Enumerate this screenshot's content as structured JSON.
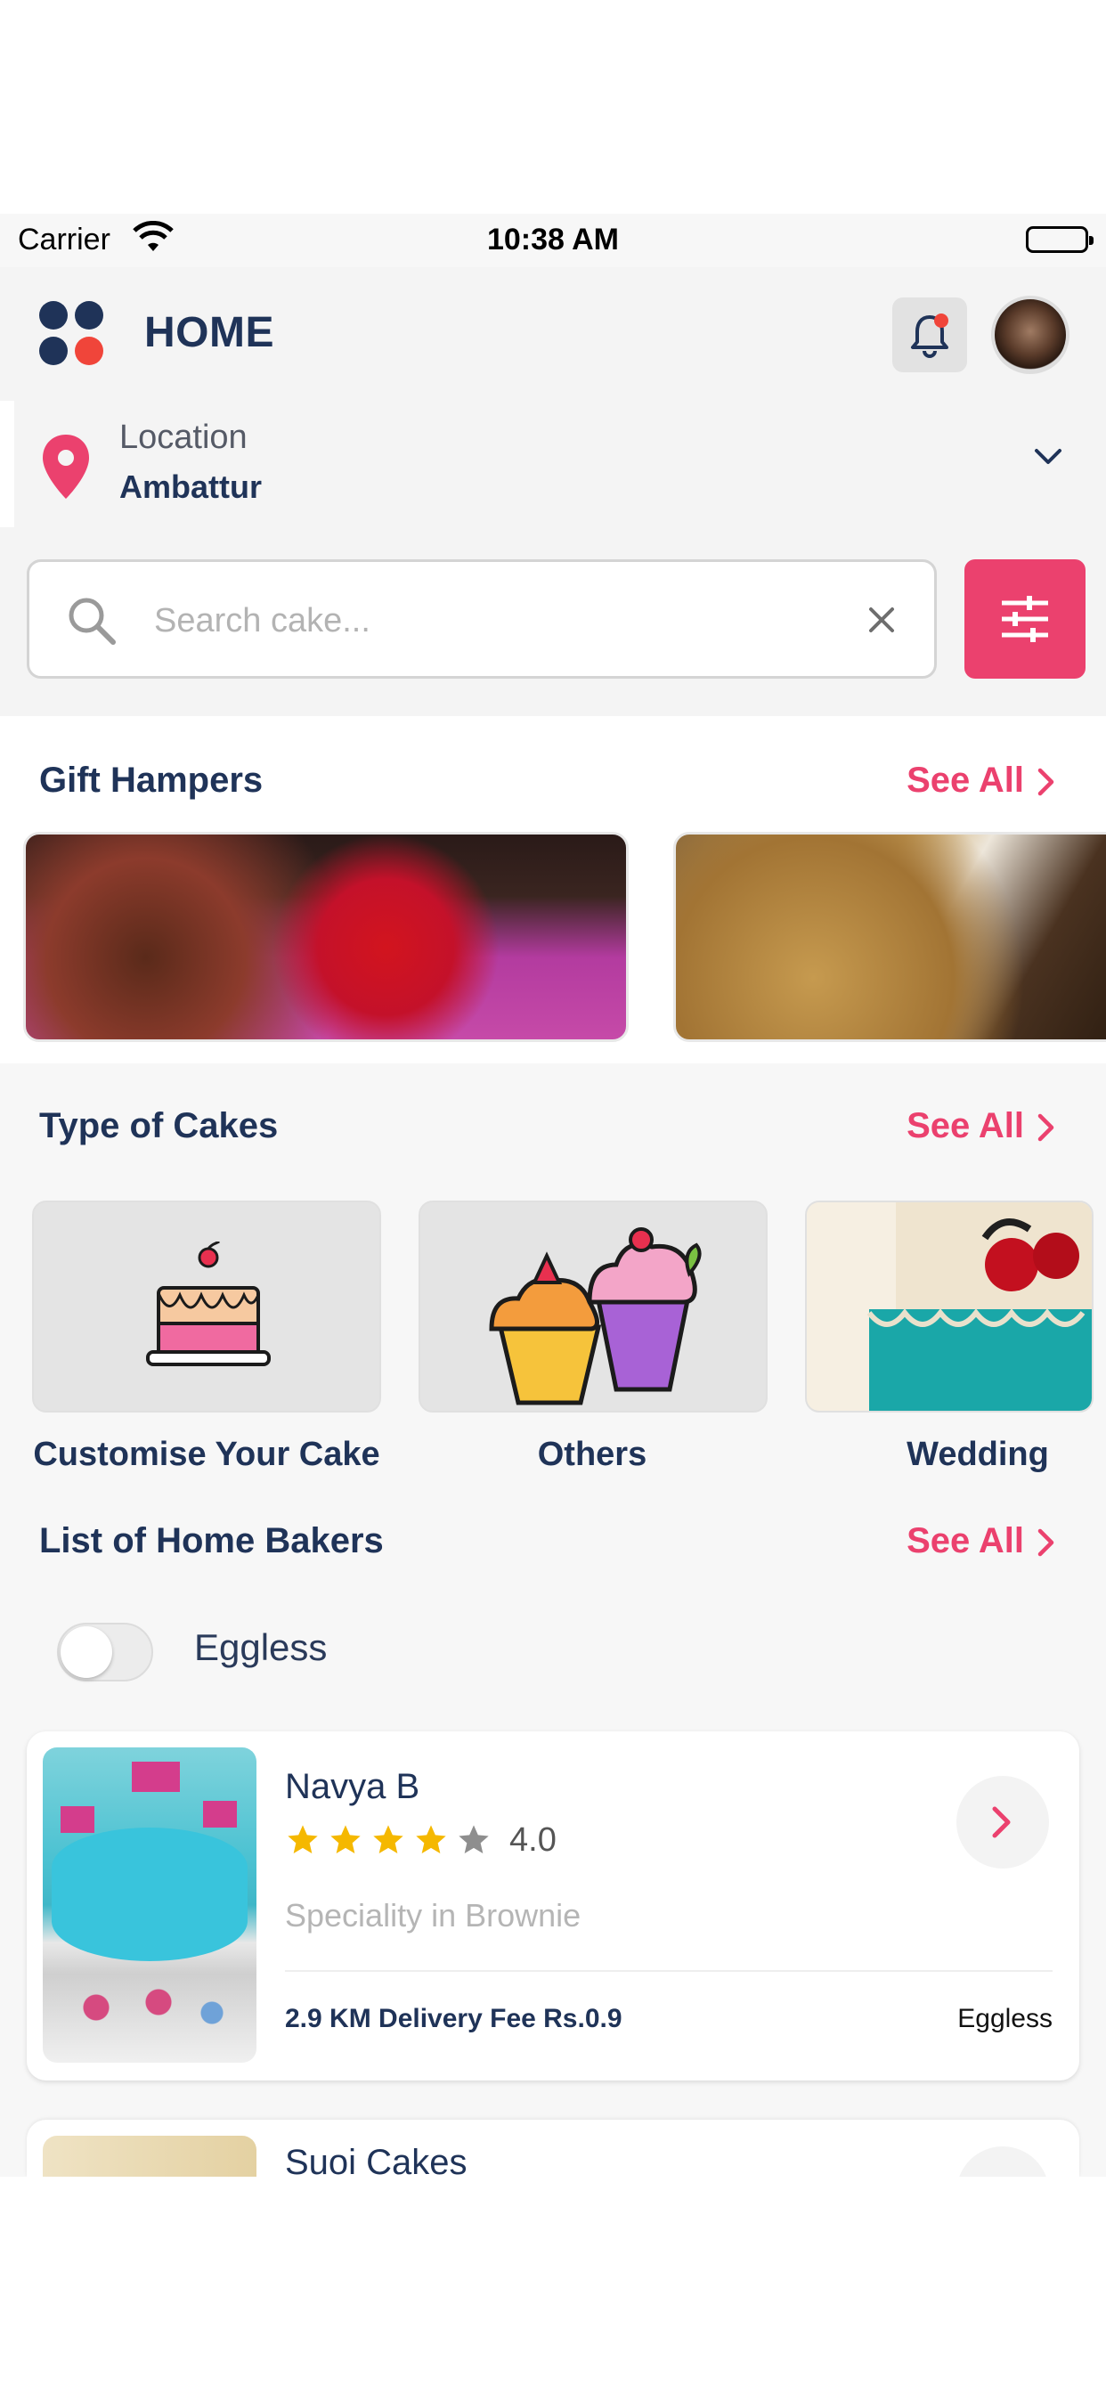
{
  "status_bar": {
    "carrier": "Carrier",
    "time": "10:38 AM"
  },
  "header": {
    "title": "HOME"
  },
  "location": {
    "label": "Location",
    "value": "Ambattur"
  },
  "search": {
    "placeholder": "Search cake..."
  },
  "gift_hampers": {
    "title": "Gift Hampers",
    "see_all": "See All"
  },
  "cake_types": {
    "title": "Type of Cakes",
    "see_all": "See All",
    "items": [
      {
        "label": "Customise Your Cake",
        "icon": "cake-icon"
      },
      {
        "label": "Others",
        "icon": "cupcakes-icon"
      },
      {
        "label": "Wedding",
        "icon": "wedding-cake-photo"
      }
    ]
  },
  "home_bakers": {
    "title": "List of Home Bakers",
    "see_all": "See All",
    "filter_label": "Eggless",
    "eggless_on": false,
    "bakers": [
      {
        "name": "Navya B",
        "rating": "4.0",
        "rating_value": 4,
        "rating_max": 5,
        "speciality": "Speciality in Brownie",
        "delivery": "2.9 KM Delivery Fee Rs.0.9",
        "tag": "Eggless"
      },
      {
        "name": "Suoi Cakes"
      }
    ]
  },
  "colors": {
    "accent": "#eb416e",
    "navy": "#1f3358",
    "star": "#f5b800",
    "notification_dot": "#f0453a"
  }
}
